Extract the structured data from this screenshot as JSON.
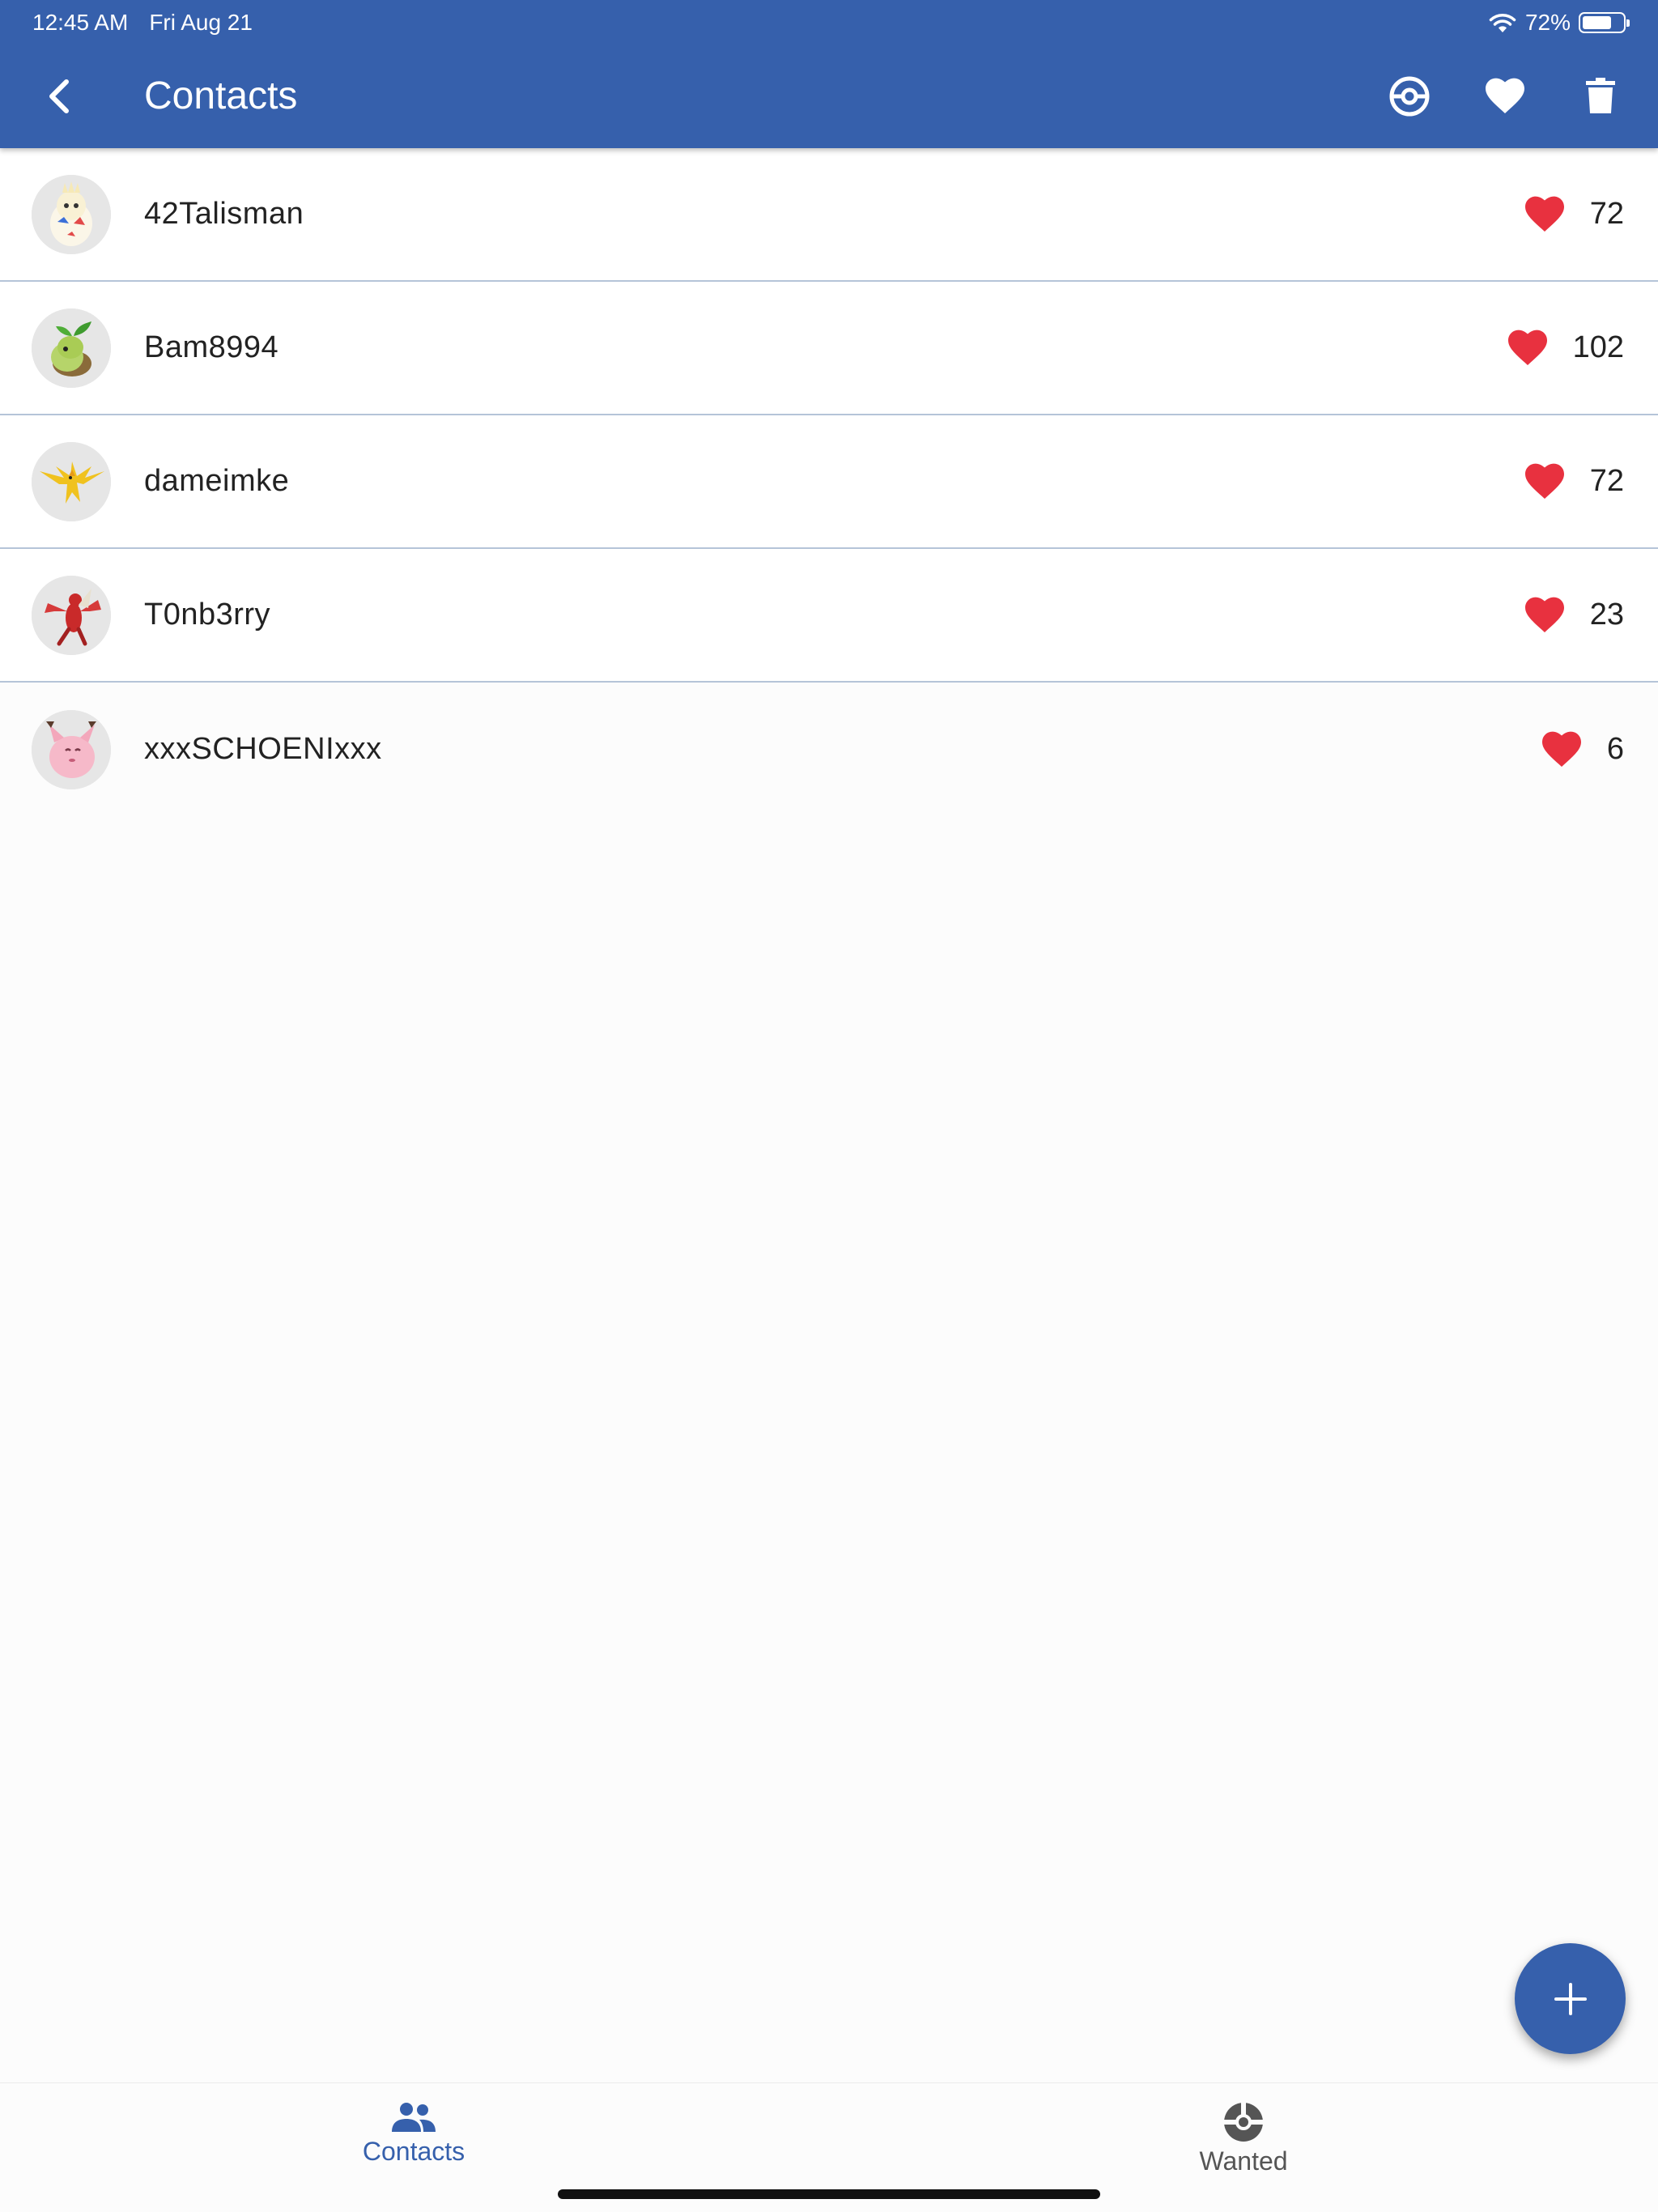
{
  "status_bar": {
    "time": "12:45 AM",
    "date": "Fri Aug 21",
    "battery": "72%",
    "battery_level": 0.72
  },
  "header": {
    "title": "Contacts",
    "actions": [
      "pokeball-icon",
      "heart-icon",
      "trash-icon"
    ]
  },
  "contacts": [
    {
      "name": "42Talisman",
      "likes": "72",
      "avatar": "togepi"
    },
    {
      "name": "Bam8994",
      "likes": "102",
      "avatar": "turtwig"
    },
    {
      "name": "dameimke",
      "likes": "72",
      "avatar": "zapdos"
    },
    {
      "name": "T0nb3rry",
      "likes": "23",
      "avatar": "scizor"
    },
    {
      "name": "xxxSCHOENIxxx",
      "likes": "6",
      "avatar": "clefairy"
    }
  ],
  "bottom_nav": {
    "contacts_label": "Contacts",
    "wanted_label": "Wanted"
  },
  "colors": {
    "primary": "#3660ac",
    "heart": "#e8313f",
    "divider": "#b5c4d8"
  }
}
